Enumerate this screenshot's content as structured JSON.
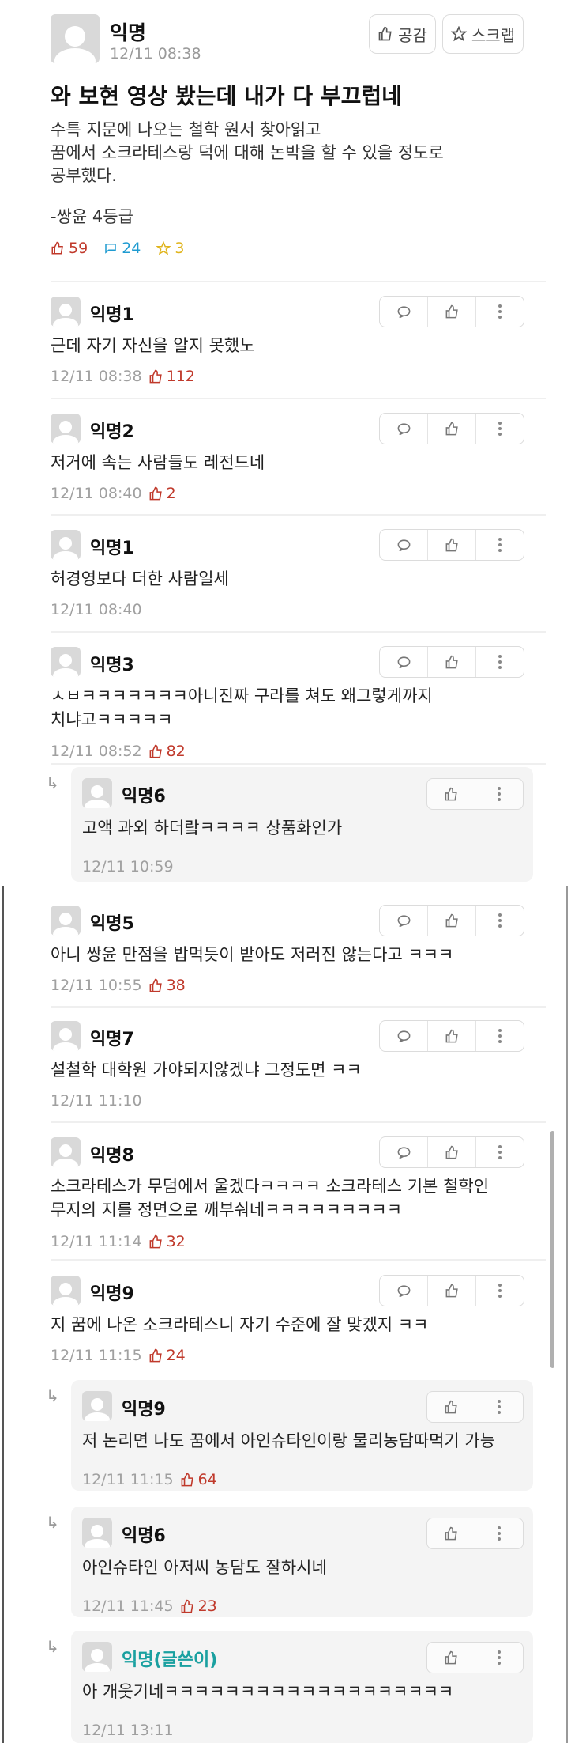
{
  "post": {
    "author": "익명",
    "time": "12/11 08:38",
    "like_button": "공감",
    "scrap_button": "스크랩",
    "title": "와 보현 영상 봤는데 내가 다 부끄럽네",
    "body": "수특 지문에 나오는 철학 원서 찾아읽고\n꿈에서 소크라테스랑 덕에 대해 논박을 할 수 있을 정도로\n공부했다.",
    "signature": "-쌍윤 4등급",
    "stats": {
      "likes": "59",
      "comments": "24",
      "scraps": "3"
    }
  },
  "comments": [
    {
      "author": "익명1",
      "text": "근데 자기 자신을 알지 못했노",
      "time": "12/11 08:38",
      "likes": "112"
    },
    {
      "author": "익명2",
      "text": "저거에 속는 사람들도 레전드네",
      "time": "12/11 08:40",
      "likes": "2"
    },
    {
      "author": "익명1",
      "text": "허경영보다 더한 사람일세",
      "time": "12/11 08:40",
      "likes": ""
    },
    {
      "author": "익명3",
      "text": "ㅅㅂㅋㅋㅋㅋㅋㅋㅋ아니진짜 구라를 쳐도 왜그렇게까지\n치냐고ㅋㅋㅋㅋㅋ",
      "time": "12/11 08:52",
      "likes": "82"
    },
    {
      "author": "익명6",
      "text": "고액 과외 하더랔ㅋㅋㅋㅋ 상품화인가",
      "time": "12/11 10:59",
      "likes": "",
      "reply": true
    },
    {
      "author": "익명5",
      "text": "아니 쌍윤 만점을 밥먹듯이 받아도 저러진 않는다고 ㅋㅋㅋ",
      "time": "12/11 10:55",
      "likes": "38"
    },
    {
      "author": "익명7",
      "text": "설철학 대학원 가야되지않겠냐 그정도면 ㅋㅋ",
      "time": "12/11 11:10",
      "likes": ""
    },
    {
      "author": "익명8",
      "text": "소크라테스가 무덤에서 울겠다ㅋㅋㅋㅋ 소크라테스 기본 철학인\n무지의 지를 정면으로 깨부숴네ㅋㅋㅋㅋㅋㅋㅋㅋㅋ",
      "time": "12/11 11:14",
      "likes": "32"
    },
    {
      "author": "익명9",
      "text": "지 꿈에 나온 소크라테스니 자기 수준에 잘 맞겠지 ㅋㅋ",
      "time": "12/11 11:15",
      "likes": "24"
    },
    {
      "author": "익명9",
      "text": "저 논리면 나도 꿈에서 아인슈타인이랑 물리농담따먹기 가능",
      "time": "12/11 11:15",
      "likes": "64",
      "reply": true
    },
    {
      "author": "익명6",
      "text": "아인슈타인 아저씨 농담도 잘하시네",
      "time": "12/11 11:45",
      "likes": "23",
      "reply": true
    },
    {
      "author": "익명(글쓴이)",
      "text": "아 개웃기네ㅋㅋㅋㅋㅋㅋㅋㅋㅋㅋㅋㅋㅋㅋㅋㅋㅋㅋㅋ",
      "time": "12/11 13:11",
      "likes": "",
      "reply": true
    }
  ],
  "colors": {
    "like_red": "#c0392b",
    "comment_blue": "#1f9bd1",
    "scrap_yellow": "#e0b41c",
    "op_teal": "#1aa0a0"
  },
  "icons": {
    "comment": "speech-bubble-icon",
    "like": "thumbs-up-icon",
    "more": "more-vertical-icon",
    "reply": "reply-arrow-icon",
    "scrap": "star-icon"
  }
}
